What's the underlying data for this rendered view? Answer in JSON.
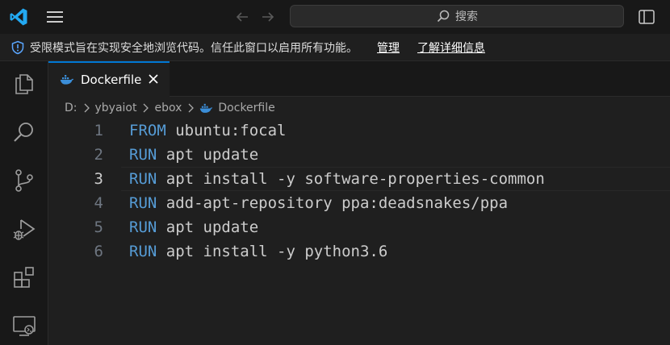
{
  "search": {
    "label": "搜索"
  },
  "restricted": {
    "message": "受限模式旨在实现安全地浏览代码。信任此窗口以启用所有功能。",
    "manage_link": "管理",
    "learn_more_link": "了解详细信息"
  },
  "tab": {
    "title": "Dockerfile"
  },
  "breadcrumb": [
    "D:",
    "ybyaiot",
    "ebox",
    "Dockerfile"
  ],
  "code": {
    "active_line": 3,
    "lines": [
      {
        "number": "1",
        "keyword": "FROM",
        "rest": " ubuntu:focal"
      },
      {
        "number": "2",
        "keyword": "RUN",
        "rest": " apt update"
      },
      {
        "number": "3",
        "keyword": "RUN",
        "rest": " apt install -y software-properties-common"
      },
      {
        "number": "4",
        "keyword": "RUN",
        "rest": " add-apt-repository ppa:deadsnakes/ppa"
      },
      {
        "number": "5",
        "keyword": "RUN",
        "rest": " apt update"
      },
      {
        "number": "6",
        "keyword": "RUN",
        "rest": " apt install -y python3.6"
      }
    ]
  },
  "colors": {
    "accent": "#0078d4",
    "keyword": "#569cd6",
    "logo": "#23a9f2"
  },
  "icons": [
    "vscode-logo-icon",
    "menu-icon",
    "arrow-left-icon",
    "arrow-right-icon",
    "search-icon",
    "layout-sidebar-icon",
    "shield-icon",
    "explorer-icon",
    "search-view-icon",
    "source-control-icon",
    "run-debug-icon",
    "extensions-icon",
    "remote-explorer-icon",
    "docker-icon",
    "close-icon",
    "chevron-right-icon"
  ]
}
